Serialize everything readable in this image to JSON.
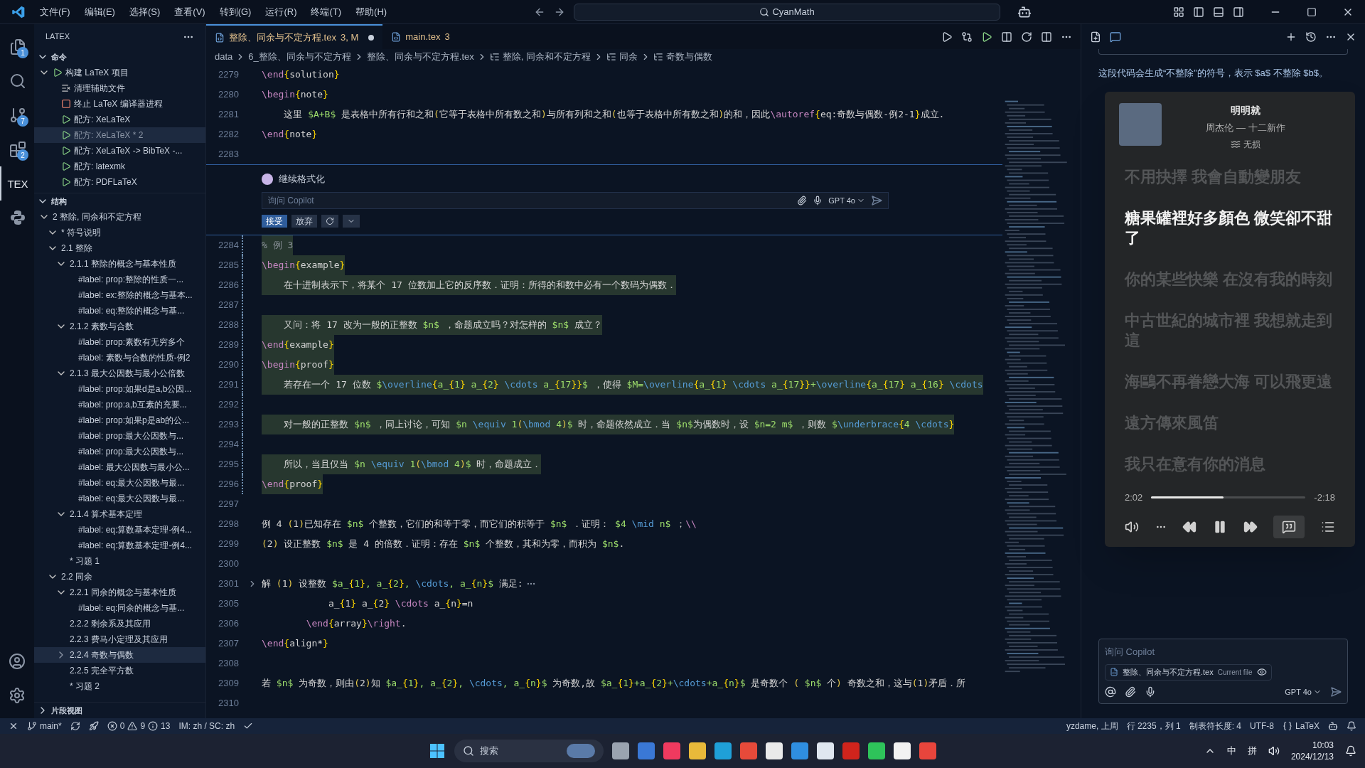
{
  "title_bar": {
    "menus": [
      "文件(F)",
      "编辑(E)",
      "选择(S)",
      "查看(V)",
      "转到(G)",
      "运行(R)",
      "终端(T)",
      "帮助(H)"
    ],
    "search": "CyanMath"
  },
  "activity_bar": {
    "items": [
      {
        "kind": "files",
        "badge": "1",
        "selected": false
      },
      {
        "kind": "search",
        "selected": false
      },
      {
        "kind": "git",
        "badge": "7",
        "selected": false
      },
      {
        "kind": "extensions",
        "badge": "2",
        "selected": false
      },
      {
        "kind": "tex",
        "label": "TEX",
        "selected": true
      },
      {
        "kind": "python",
        "selected": false
      }
    ]
  },
  "sidebar": {
    "title": "LATEX",
    "commands": {
      "title": "命令",
      "expanded": true,
      "items": [
        {
          "label": "构建 LaTeX 项目",
          "kind": "play",
          "expanded": true,
          "selected": false,
          "children": [
            {
              "label": "清理辅助文件",
              "kind": "clear",
              "selected": false
            },
            {
              "label": "终止 LaTeX 编译器进程",
              "kind": "stop",
              "selected": false
            },
            {
              "label": "配方: XeLaTeX",
              "kind": "play",
              "selected": false
            },
            {
              "label": "配方: XeLaTeX * 2",
              "kind": "play",
              "selected": true
            },
            {
              "label": "配方: XeLaTeX -> BibTeX -...",
              "kind": "play",
              "selected": false
            },
            {
              "label": "配方: latexmk",
              "kind": "play",
              "selected": false
            },
            {
              "label": "配方: PDFLaTeX",
              "kind": "play",
              "selected": false
            }
          ]
        }
      ]
    },
    "outline": {
      "title": "结构",
      "expanded": true,
      "items": [
        {
          "label": "2 整除, 同余和不定方程",
          "expanded": true,
          "selected": false,
          "children": [
            {
              "label": "* 符号说明",
              "expanded": true,
              "selected": false
            },
            {
              "label": "2.1 整除",
              "expanded": true,
              "selected": false,
              "children": [
                {
                  "label": "2.1.1 整除的概念与基本性质",
                  "expanded": true,
                  "selected": false,
                  "children": [
                    {
                      "label": "#label: prop:整除的性质一...",
                      "selected": false
                    },
                    {
                      "label": "#label: ex:整除的概念与基本...",
                      "selected": false
                    },
                    {
                      "label": "#label: eq:整除的概念与基...",
                      "selected": false
                    }
                  ]
                },
                {
                  "label": "2.1.2 素数与合数",
                  "expanded": true,
                  "selected": false,
                  "children": [
                    {
                      "label": "#label: prop:素数有无穷多个",
                      "selected": false
                    },
                    {
                      "label": "#label: 素数与合数的性质-例2",
                      "selected": false
                    }
                  ]
                },
                {
                  "label": "2.1.3 最大公因数与最小公倍数",
                  "expanded": true,
                  "selected": false,
                  "children": [
                    {
                      "label": "#label: prop:如果d是a,b公因...",
                      "selected": false
                    },
                    {
                      "label": "#label: prop:a,b互素的充要...",
                      "selected": false
                    },
                    {
                      "label": "#label: prop:如果p是ab的公...",
                      "selected": false
                    },
                    {
                      "label": "#label: prop:最大公因数与...",
                      "selected": false
                    },
                    {
                      "label": "#label: prop:最大公因数与...",
                      "selected": false
                    },
                    {
                      "label": "#label: 最大公因数与最小公...",
                      "selected": false
                    },
                    {
                      "label": "#label: eq:最大公因数与最...",
                      "selected": false
                    },
                    {
                      "label": "#label: eq:最大公因数与最...",
                      "selected": false
                    }
                  ]
                },
                {
                  "label": "2.1.4 算术基本定理",
                  "expanded": true,
                  "selected": false,
                  "children": [
                    {
                      "label": "#label: eq:算数基本定理-例4...",
                      "selected": false
                    },
                    {
                      "label": "#label: eq:算数基本定理-例4...",
                      "selected": false
                    }
                  ]
                },
                {
                  "label": "* 习题 1",
                  "selected": false
                }
              ]
            },
            {
              "label": "2.2 同余",
              "expanded": true,
              "selected": false,
              "children": [
                {
                  "label": "2.2.1 同余的概念与基本性质",
                  "expanded": true,
                  "selected": false,
                  "children": [
                    {
                      "label": "#label: eq:同余的概念与基...",
                      "selected": false
                    }
                  ]
                },
                {
                  "label": "2.2.2 剩余系及其应用",
                  "selected": false
                },
                {
                  "label": "2.2.3 费马小定理及其应用",
                  "selected": false
                },
                {
                  "label": "2.2.4 奇数与偶数",
                  "expanded": false,
                  "selected": true
                },
                {
                  "label": "2.2.5 完全平方数",
                  "selected": false
                },
                {
                  "label": "* 习题 2",
                  "selected": false
                }
              ]
            }
          ]
        }
      ]
    },
    "snippets": {
      "title": "片段视图",
      "expanded": false
    }
  },
  "tabs": [
    {
      "label": "整除、同余与不定方程.tex",
      "status": "3, M",
      "modified": true,
      "selected": true
    },
    {
      "label": "main.tex",
      "status": "3",
      "modified": false,
      "selected": false
    }
  ],
  "breadcrumbs": [
    "data",
    "6_整除、同余与不定方程",
    "整除、同余与不定方程.tex",
    "整除, 同余和不定方程",
    "同余",
    "奇数与偶数"
  ],
  "code_top": [
    {
      "num": "2279",
      "text": "\\end{solution}",
      "changed": false
    },
    {
      "num": "2280",
      "text": "\\begin{note}",
      "changed": false
    },
    {
      "num": "2281",
      "text": "    这里 $A+B$ 是表格中所有行和之和(它等于表格中所有数之和)与所有列和之和(也等于表格中所有数之和)的和，因此\\autoref{eq:奇数与偶数-例2-1}成立.",
      "changed": false
    },
    {
      "num": "2282",
      "text": "\\end{note}",
      "changed": false
    },
    {
      "num": "2283",
      "changed": false
    }
  ],
  "inline_chat": {
    "title": "继续格式化",
    "placeholder": "询问 Copilot",
    "model": "GPT 4o",
    "accept": "接受",
    "discard": "放弃"
  },
  "code_bottom": [
    {
      "num": "2284",
      "text": "% 例 3",
      "changed": true
    },
    {
      "num": "2285",
      "text": "\\begin{example}",
      "changed": true
    },
    {
      "num": "2286",
      "text": "    在十进制表示下，将某个 17 位数加上它的反序数．证明：所得的和数中必有一个数码为偶数．",
      "changed": true
    },
    {
      "num": "2287",
      "changed": true
    },
    {
      "num": "2288",
      "text": "    又问：将 17 改为一般的正整数 $n$ ，命题成立吗？对怎样的 $n$ 成立？",
      "changed": true
    },
    {
      "num": "2289",
      "text": "\\end{example}",
      "changed": true
    },
    {
      "num": "2290",
      "text": "\\begin{proof}",
      "changed": true
    },
    {
      "num": "2291",
      "text": "    若存在一个 17 位数 $\\overline{a_{1} a_{2} \\cdots a_{17}}$ ，使得 $M=\\overline{a_{1} \\cdots a_{17}}+\\overline{a_{17} a_{16} \\cdots",
      "changed": true
    },
    {
      "num": "2292",
      "changed": true
    },
    {
      "num": "2293",
      "text": "    对一般的正整数 $n$ ，同上讨论，可知 $n \\equiv 1(\\bmod 4)$ 时，命题依然成立．当 $n$为偶数时，设 $n=2 m$ ，则数 $\\underbrace{4 \\cdots}",
      "changed": true
    },
    {
      "num": "2294",
      "changed": true
    },
    {
      "num": "2295",
      "text": "    所以，当且仅当 $n \\equiv 1(\\bmod 4)$ 时，命题成立．",
      "changed": true
    },
    {
      "num": "2296",
      "text": "\\end{proof}",
      "changed": true
    },
    {
      "num": "2297",
      "changed": false
    },
    {
      "num": "2298",
      "text": "例 4 (1)已知存在 $n$ 个整数，它们的和等于零，而它们的积等于 $n$ ．证明： $4 \\mid n$ ；\\\\",
      "changed": false
    },
    {
      "num": "2299",
      "text": "(2) 设正整数 $n$ 是 4 的倍数．证明：存在 $n$ 个整数，其和为零，而积为 $n$.",
      "changed": false
    },
    {
      "num": "2300",
      "changed": false
    },
    {
      "num": "2301",
      "text": "解 (1) 设整数 $a_{1}, a_{2}, \\cdots, a_{n}$ 满足:",
      "changed": false,
      "folded": true
    },
    {
      "num": "2305",
      "text": "            a_{1} a_{2} \\cdots a_{n}=n",
      "changed": false
    },
    {
      "num": "2306",
      "text": "        \\end{array}\\right.",
      "changed": false
    },
    {
      "num": "2307",
      "text": "\\end{align*}",
      "changed": false
    },
    {
      "num": "2308",
      "changed": false
    },
    {
      "num": "2309",
      "text": "若 $n$ 为奇数，则由(2)知 $a_{1}, a_{2}, \\cdots, a_{n}$ 为奇数,故 $a_{1}+a_{2}+\\cdots+a_{n}$ 是奇数个 ( $n$ 个) 奇数之和，这与(1)矛盾．所",
      "changed": false
    },
    {
      "num": "2310",
      "changed": false
    }
  ],
  "chat": {
    "message": "这段代码会生成“不整除”的符号，表示 $a$ 不整除 $b$。",
    "input_placeholder": "询问 Copilot",
    "file_chip": "整除、同余与不定方程.tex",
    "file_chip_note": "Current file",
    "model": "GPT 4o"
  },
  "music_player": {
    "song": "明明就",
    "artist": "周杰伦 — 十二新作",
    "quality": "无损",
    "elapsed": "2:02",
    "remaining": "-2:18",
    "level": 0.47,
    "playing": true,
    "lyrics": [
      {
        "text": "不用抉擇 我會自動變朋友",
        "selected": false
      },
      {
        "text": "糖果罐裡好多顏色 微笑卻不甜了",
        "selected": true
      },
      {
        "text": "你的某些快樂 在沒有我的時刻",
        "selected": false
      },
      {
        "text": "中古世紀的城市裡 我想就走到這",
        "selected": false
      },
      {
        "text": "海鷗不再眷戀大海 可以飛更遠",
        "selected": false
      },
      {
        "text": "遠方傳來風笛",
        "selected": false
      },
      {
        "text": "我只在意有你的消息",
        "selected": false
      }
    ]
  },
  "status_bar": {
    "branch": "main*",
    "errors": "0",
    "warnings": "9",
    "infos": "13",
    "ime": "IM: zh / SC: zh",
    "blame": "yzdame, 上周",
    "position": "行 2235，列 1",
    "tab_size": "制表符长度: 4",
    "encoding": "UTF-8",
    "language": "LaTeX"
  },
  "taskbar": {
    "search": "搜索",
    "tray": [
      "中",
      "拼"
    ],
    "time": "10:03",
    "date": "2024/12/13"
  }
}
